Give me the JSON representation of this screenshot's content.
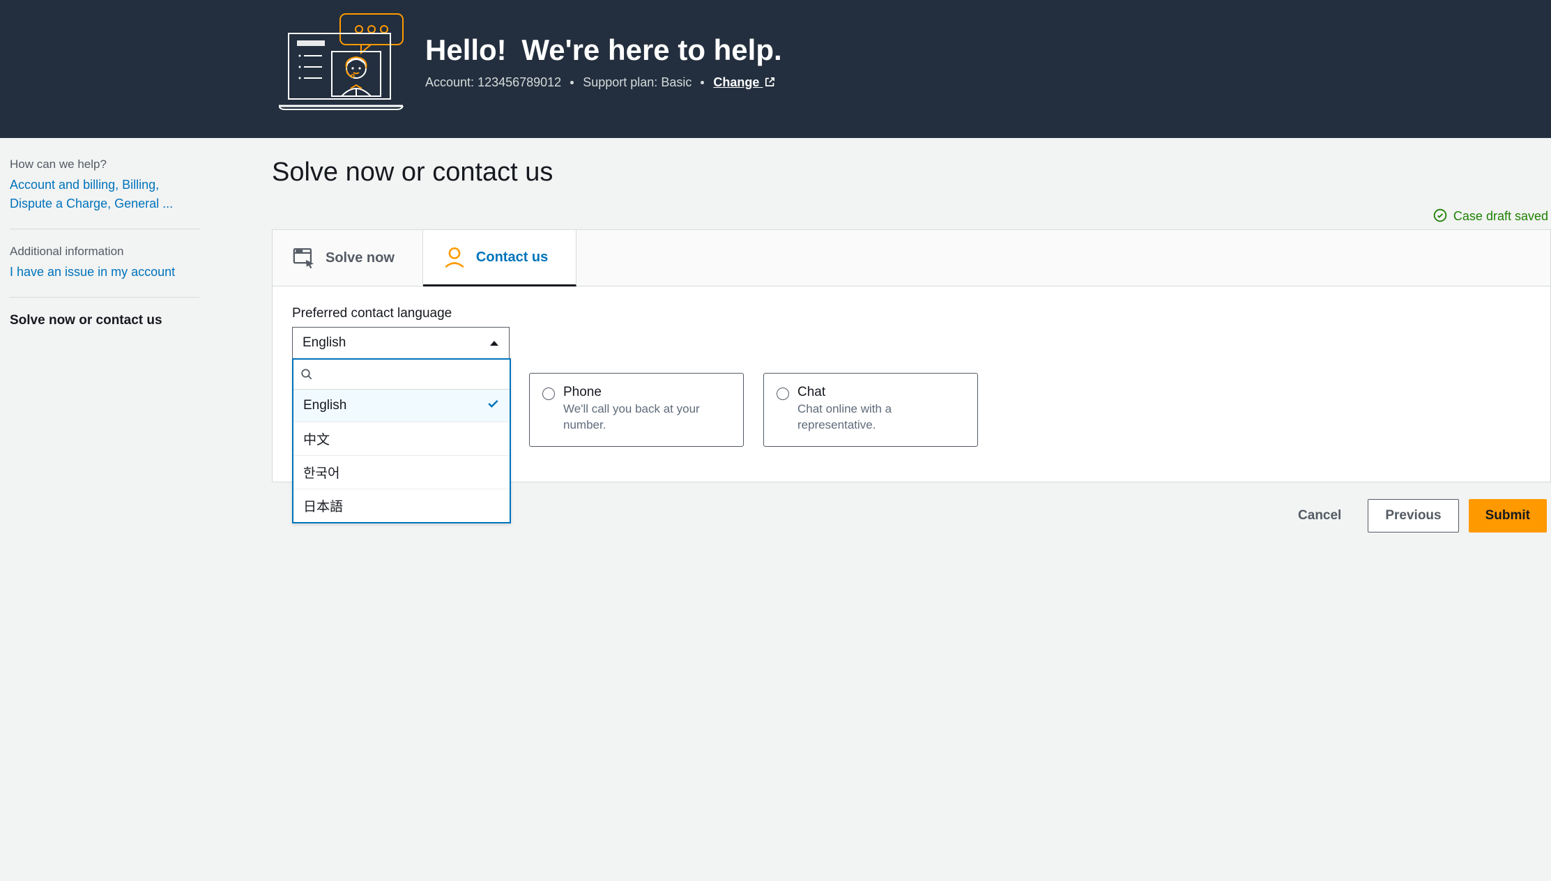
{
  "header": {
    "title_a": "Hello!",
    "title_b": "We're here to help.",
    "account_label": "Account:",
    "account_id": "123456789012",
    "plan_label": "Support plan:",
    "plan_value": "Basic",
    "change_label": "Change"
  },
  "sidebar": {
    "help_label": "How can we help?",
    "help_link": "Account and billing, Billing, Dispute a Charge, General ...",
    "addl_label": "Additional information",
    "addl_link": "I have an issue in my account",
    "current": "Solve now or contact us"
  },
  "main": {
    "title": "Solve now or contact us",
    "draft_saved": "Case draft saved"
  },
  "tabs": {
    "solve_now": "Solve now",
    "contact_us": "Contact us"
  },
  "language": {
    "label": "Preferred contact language",
    "selected": "English",
    "search_placeholder": "",
    "options": [
      "English",
      "中文",
      "한국어",
      "日本語"
    ]
  },
  "contact_options": {
    "phone": {
      "title": "Phone",
      "desc": "We'll call you back at your number."
    },
    "chat": {
      "title": "Chat",
      "desc": "Chat online with a representative."
    }
  },
  "buttons": {
    "cancel": "Cancel",
    "previous": "Previous",
    "submit": "Submit"
  }
}
